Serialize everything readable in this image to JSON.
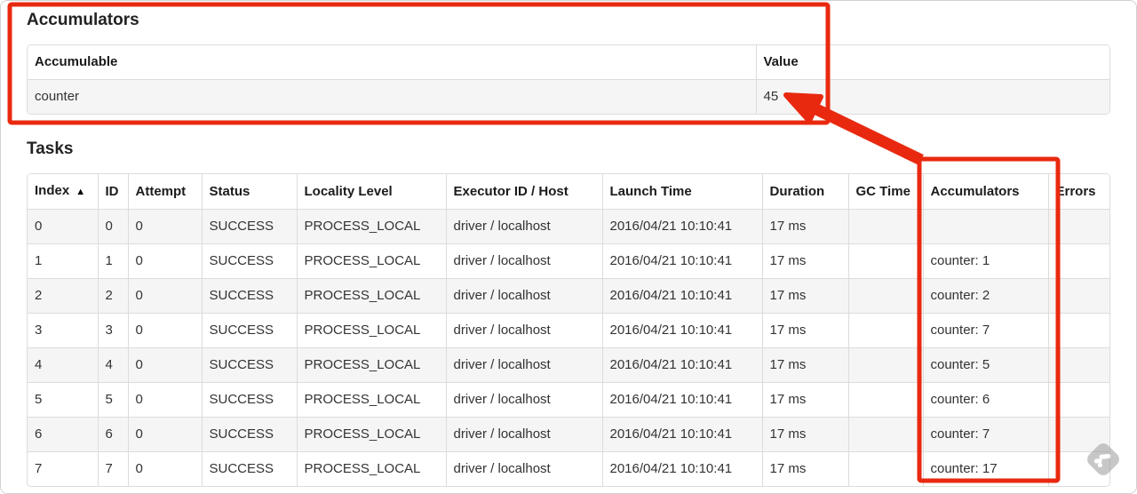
{
  "annotations": {
    "color": "#e9290f"
  },
  "accumulators_section": {
    "title": "Accumulators",
    "table": {
      "headers": {
        "accumulable": "Accumulable",
        "value": "Value"
      },
      "rows": [
        {
          "accumulable": "counter",
          "value": "45"
        }
      ]
    }
  },
  "tasks_section": {
    "title": "Tasks",
    "table": {
      "headers": {
        "index": "Index",
        "sort_indicator": "▲",
        "id": "ID",
        "attempt": "Attempt",
        "status": "Status",
        "locality_level": "Locality Level",
        "executor_id_host": "Executor ID / Host",
        "launch_time": "Launch Time",
        "duration": "Duration",
        "gc_time": "GC Time",
        "accumulators": "Accumulators",
        "errors": "Errors"
      },
      "rows": [
        {
          "index": "0",
          "id": "0",
          "attempt": "0",
          "status": "SUCCESS",
          "locality_level": "PROCESS_LOCAL",
          "executor_id_host": "driver / localhost",
          "launch_time": "2016/04/21 10:10:41",
          "duration": "17 ms",
          "gc_time": "",
          "accumulators": "",
          "errors": ""
        },
        {
          "index": "1",
          "id": "1",
          "attempt": "0",
          "status": "SUCCESS",
          "locality_level": "PROCESS_LOCAL",
          "executor_id_host": "driver / localhost",
          "launch_time": "2016/04/21 10:10:41",
          "duration": "17 ms",
          "gc_time": "",
          "accumulators": "counter: 1",
          "errors": ""
        },
        {
          "index": "2",
          "id": "2",
          "attempt": "0",
          "status": "SUCCESS",
          "locality_level": "PROCESS_LOCAL",
          "executor_id_host": "driver / localhost",
          "launch_time": "2016/04/21 10:10:41",
          "duration": "17 ms",
          "gc_time": "",
          "accumulators": "counter: 2",
          "errors": ""
        },
        {
          "index": "3",
          "id": "3",
          "attempt": "0",
          "status": "SUCCESS",
          "locality_level": "PROCESS_LOCAL",
          "executor_id_host": "driver / localhost",
          "launch_time": "2016/04/21 10:10:41",
          "duration": "17 ms",
          "gc_time": "",
          "accumulators": "counter: 7",
          "errors": ""
        },
        {
          "index": "4",
          "id": "4",
          "attempt": "0",
          "status": "SUCCESS",
          "locality_level": "PROCESS_LOCAL",
          "executor_id_host": "driver / localhost",
          "launch_time": "2016/04/21 10:10:41",
          "duration": "17 ms",
          "gc_time": "",
          "accumulators": "counter: 5",
          "errors": ""
        },
        {
          "index": "5",
          "id": "5",
          "attempt": "0",
          "status": "SUCCESS",
          "locality_level": "PROCESS_LOCAL",
          "executor_id_host": "driver / localhost",
          "launch_time": "2016/04/21 10:10:41",
          "duration": "17 ms",
          "gc_time": "",
          "accumulators": "counter: 6",
          "errors": ""
        },
        {
          "index": "6",
          "id": "6",
          "attempt": "0",
          "status": "SUCCESS",
          "locality_level": "PROCESS_LOCAL",
          "executor_id_host": "driver / localhost",
          "launch_time": "2016/04/21 10:10:41",
          "duration": "17 ms",
          "gc_time": "",
          "accumulators": "counter: 7",
          "errors": ""
        },
        {
          "index": "7",
          "id": "7",
          "attempt": "0",
          "status": "SUCCESS",
          "locality_level": "PROCESS_LOCAL",
          "executor_id_host": "driver / localhost",
          "launch_time": "2016/04/21 10:10:41",
          "duration": "17 ms",
          "gc_time": "",
          "accumulators": "counter: 17",
          "errors": ""
        }
      ]
    }
  }
}
